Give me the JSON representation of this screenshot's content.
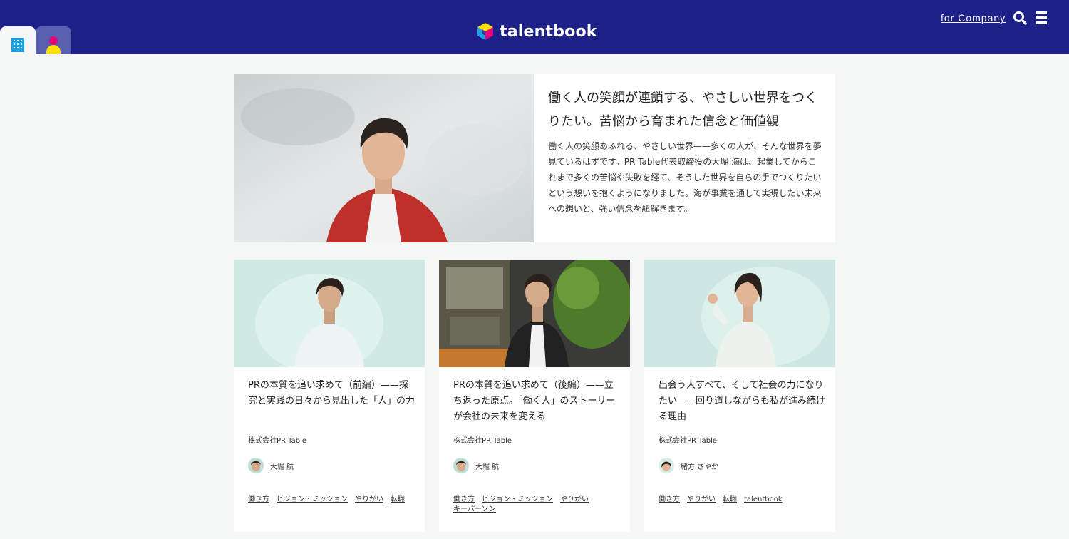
{
  "header": {
    "logo_text": "talentbook",
    "for_company": "for Company",
    "search_icon": "search-icon",
    "menu_icon": "hamburger-menu-icon",
    "tabs": [
      {
        "icon": "building-icon"
      },
      {
        "icon": "person-icon"
      }
    ],
    "colors": {
      "header_bg": "#1d2087",
      "accent_blue": "#1ba2e6",
      "accent_pink": "#e4007f",
      "accent_yellow": "#ffe100"
    }
  },
  "featured": {
    "title": "働く人の笑顔が連鎖する、やさしい世界をつくりたい。苦悩から育まれた信念と価値観",
    "description": "働く人の笑顔あふれる、やさしい世界——多くの人が、そんな世界を夢見ているはずです。PR Table代表取締役の大堀 海は、起業してからこれまで多くの苦悩や失敗を経て、そうした世界を自らの手でつくりたいという想いを抱くようになりました。海が事業を通して実現したい未来への想いと、強い信念を紐解きます。"
  },
  "cards": [
    {
      "title": "PRの本質を追い求めて（前編）——探究と実践の日々から見出した「人」の力",
      "company": "株式会社PR Table",
      "author": "大堀 航",
      "tags": [
        "働き方",
        "ビジョン・ミッション",
        "やりがい",
        "転職"
      ]
    },
    {
      "title": "PRの本質を追い求めて（後編）——立ち返った原点。「働く人」のストーリーが会社の未来を変える",
      "company": "株式会社PR Table",
      "author": "大堀 航",
      "tags": [
        "働き方",
        "ビジョン・ミッション",
        "やりがい",
        "キーパーソン"
      ]
    },
    {
      "title": "出会う人すべて、そして社会の力になりたい——回り道しながらも私が進み続ける理由",
      "company": "株式会社PR Table",
      "author": "緒方 さやか",
      "tags": [
        "働き方",
        "やりがい",
        "転職",
        "talentbook"
      ]
    }
  ]
}
